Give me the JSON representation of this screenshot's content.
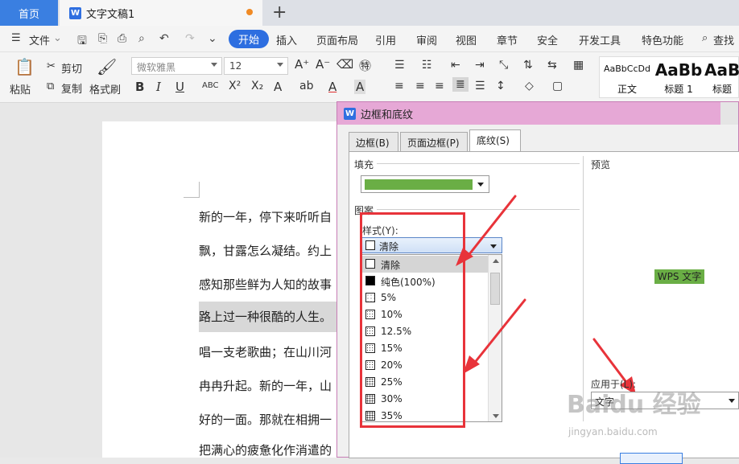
{
  "tabs": {
    "home": "首页",
    "doc": "文字文稿1",
    "doc_icon": "W",
    "new": "+"
  },
  "menu": {
    "file": "文件",
    "items": [
      "开始",
      "插入",
      "页面布局",
      "引用",
      "审阅",
      "视图",
      "章节",
      "安全",
      "开发工具",
      "特色功能"
    ],
    "search": "查找"
  },
  "ribbon": {
    "paste": "粘贴",
    "cut": "剪切",
    "copy": "复制",
    "format_painter": "格式刷",
    "font": "微软雅黑",
    "size": "12",
    "styles": [
      {
        "sample": "AaBbCcDd",
        "name": "正文"
      },
      {
        "sample": "AaBb",
        "name": "标题 1"
      },
      {
        "sample": "AaB",
        "name": "标题"
      }
    ]
  },
  "doc_lines": [
    "新的一年，停下来听听自",
    "飘，甘露怎么凝结。约上",
    "感知那些鲜为人知的故事",
    "路上过一种很酷的人生。",
    "唱一支老歌曲；在山川河",
    "冉冉升起。新的一年，山",
    "好的一面。那就在相拥一",
    "把满心的疲惫化作消遣的"
  ],
  "dialog": {
    "icon": "W",
    "title": "边框和底纹",
    "tabs": [
      "边框(B)",
      "页面边框(P)",
      "底纹(S)"
    ],
    "fill_label": "填充",
    "fill_color": "#6aae45",
    "pattern_label": "图案",
    "style_label": "样式(Y):",
    "style_value": "清除",
    "options": [
      "清除",
      "纯色(100%)",
      "5%",
      "10%",
      "12.5%",
      "15%",
      "20%",
      "25%",
      "30%",
      "35%"
    ],
    "preview_label": "预览",
    "preview_text": "WPS 文字",
    "apply_label": "应用于(L):",
    "apply_value": "文字"
  },
  "watermark": {
    "logo": "Baidu 经验",
    "url": "jingyan.baidu.com"
  },
  "colors": {
    "accent": "#2d6ee0",
    "annotation": "#e8333a",
    "shading": "#6aae45"
  }
}
